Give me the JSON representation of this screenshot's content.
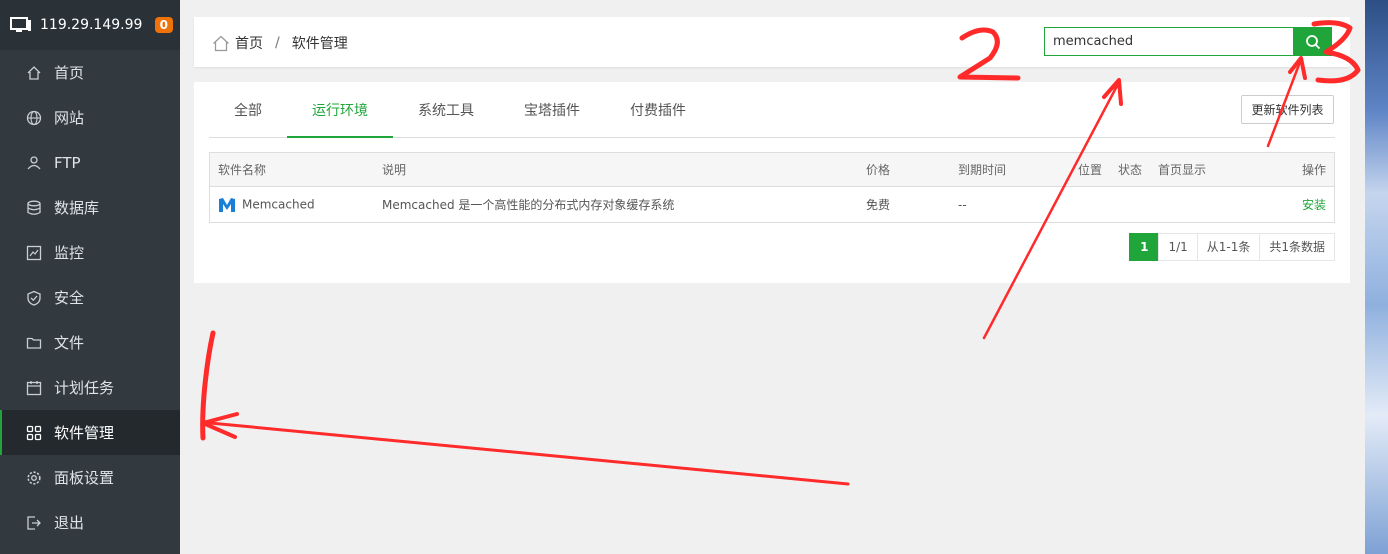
{
  "sidebar": {
    "ip": "119.29.149.99",
    "badge": "0",
    "items": [
      {
        "label": "首页",
        "icon": "home-icon"
      },
      {
        "label": "网站",
        "icon": "globe-icon"
      },
      {
        "label": "FTP",
        "icon": "ftp-icon"
      },
      {
        "label": "数据库",
        "icon": "database-icon"
      },
      {
        "label": "监控",
        "icon": "monitor-chart-icon"
      },
      {
        "label": "安全",
        "icon": "shield-icon"
      },
      {
        "label": "文件",
        "icon": "folder-icon"
      },
      {
        "label": "计划任务",
        "icon": "calendar-icon"
      },
      {
        "label": "软件管理",
        "icon": "grid-icon"
      },
      {
        "label": "面板设置",
        "icon": "gear-icon"
      },
      {
        "label": "退出",
        "icon": "logout-icon"
      }
    ],
    "active_index": 8
  },
  "breadcrumb": {
    "home": "首页",
    "separator": "/",
    "current": "软件管理"
  },
  "search": {
    "value": "memcached"
  },
  "tabs": [
    "全部",
    "运行环境",
    "系统工具",
    "宝塔插件",
    "付费插件"
  ],
  "active_tab": 1,
  "update_button": "更新软件列表",
  "table": {
    "headers": [
      "软件名称",
      "说明",
      "价格",
      "到期时间",
      "位置",
      "状态",
      "首页显示",
      "操作"
    ],
    "rows": [
      {
        "name": "Memcached",
        "desc": "Memcached 是一个高性能的分布式内存对象缓存系统",
        "price": "免费",
        "expire": "--",
        "action": "安装"
      }
    ]
  },
  "pager": {
    "current": "1",
    "pages": "1/1",
    "range": "从1-1条",
    "total": "共1条数据"
  },
  "annotations": [
    "1",
    "2",
    "3"
  ],
  "colors": {
    "accent": "#20a53a",
    "sidebar": "#323a40",
    "badge": "#f0720b",
    "annotation": "#ff2a2a"
  }
}
